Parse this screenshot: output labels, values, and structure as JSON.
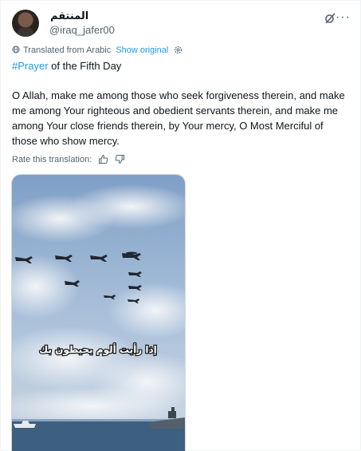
{
  "tweet": {
    "author": {
      "display_name": "المنتقم",
      "handle": "@iraq_jafer00"
    },
    "translation_notice": "Translated from Arabic",
    "show_original": "Show original",
    "hashtag": "#Prayer",
    "title_rest": " of the Fifth Day",
    "body": "O Allah, make me among those who seek forgiveness therein, and make me among Your righteous and obedient servants therein, and make me among Your close friends therein, by Your mercy, O Most Merciful of those who show mercy.",
    "rate_label": "Rate this translation:",
    "video": {
      "subtitle": "إذا رأيت ألوم يحيطون بك"
    }
  },
  "icons": {
    "grok": "grok-icon",
    "more": "more-icon",
    "globe": "globe-icon",
    "settings": "gear-icon",
    "thumbs_up": "thumbs-up-icon",
    "thumbs_down": "thumbs-down-icon"
  },
  "colors": {
    "link": "#1d9bf0",
    "text": "#0f1419",
    "muted": "#536471"
  }
}
